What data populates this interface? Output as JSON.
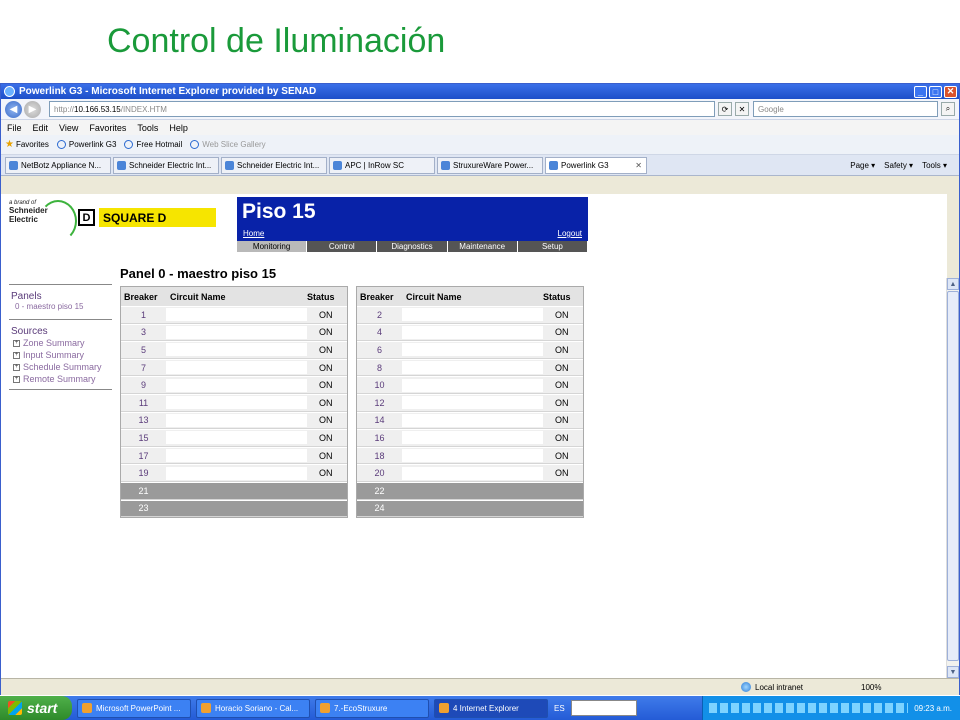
{
  "slide": {
    "title": "Control de Iluminación"
  },
  "window": {
    "title": "Powerlink G3 - Microsoft Internet Explorer provided by SENAD",
    "url_prefix": "http://",
    "url_host": "10.166.53.15",
    "url_path": "/INDEX.HTM",
    "search_placeholder": "Google"
  },
  "menu": [
    "File",
    "Edit",
    "View",
    "Favorites",
    "Tools",
    "Help"
  ],
  "favorites": {
    "label": "Favorites",
    "items": [
      "Powerlink G3",
      "Free Hotmail",
      "Web Slice Gallery"
    ]
  },
  "tabs": [
    {
      "label": "NetBotz Appliance N..."
    },
    {
      "label": "Schneider Electric Int..."
    },
    {
      "label": "Schneider Electric Int..."
    },
    {
      "label": "APC | InRow SC"
    },
    {
      "label": "StruxureWare Power..."
    },
    {
      "label": "Powerlink G3",
      "active": true
    }
  ],
  "toolbar_right": [
    "Page ▾",
    "Safety ▾",
    "Tools ▾"
  ],
  "site": {
    "brand_line": "a brand of",
    "brand_name_1": "Schneider",
    "brand_name_2": "Electric",
    "sqd_letter": "D",
    "sqd_name": "SQUARE D",
    "page_heading": "Piso 15",
    "home": "Home",
    "logout": "Logout",
    "nav": [
      "Monitoring",
      "Control",
      "Diagnostics",
      "Maintenance",
      "Setup"
    ],
    "panel_title": "Panel 0 - maestro piso 15"
  },
  "sidebar": {
    "panels_label": "Panels",
    "panel_item": "0 - maestro piso 15",
    "sources_label": "Sources",
    "sources": [
      "Zone Summary",
      "Input Summary",
      "Schedule Summary",
      "Remote Summary"
    ]
  },
  "table": {
    "headers": {
      "breaker": "Breaker",
      "circuit": "Circuit Name",
      "status": "Status"
    },
    "left": [
      {
        "num": "1",
        "status": "ON"
      },
      {
        "num": "3",
        "status": "ON"
      },
      {
        "num": "5",
        "status": "ON"
      },
      {
        "num": "7",
        "status": "ON"
      },
      {
        "num": "9",
        "status": "ON"
      },
      {
        "num": "11",
        "status": "ON"
      },
      {
        "num": "13",
        "status": "ON"
      },
      {
        "num": "15",
        "status": "ON"
      },
      {
        "num": "17",
        "status": "ON"
      },
      {
        "num": "19",
        "status": "ON"
      },
      {
        "num": "21",
        "status": ""
      },
      {
        "num": "23",
        "status": ""
      }
    ],
    "right": [
      {
        "num": "2",
        "status": "ON"
      },
      {
        "num": "4",
        "status": "ON"
      },
      {
        "num": "6",
        "status": "ON"
      },
      {
        "num": "8",
        "status": "ON"
      },
      {
        "num": "10",
        "status": "ON"
      },
      {
        "num": "12",
        "status": "ON"
      },
      {
        "num": "14",
        "status": "ON"
      },
      {
        "num": "16",
        "status": "ON"
      },
      {
        "num": "18",
        "status": "ON"
      },
      {
        "num": "20",
        "status": "ON"
      },
      {
        "num": "22",
        "status": ""
      },
      {
        "num": "24",
        "status": ""
      }
    ]
  },
  "statusbar": {
    "zone": "Local intranet",
    "zoom": "100%"
  },
  "taskbar": {
    "start": "start",
    "tasks": [
      "Microsoft PowerPoint ...",
      "Horacio Soriano - Cal...",
      "7.-EcoStruxure",
      "4 Internet Explorer"
    ],
    "lang": "ES",
    "clock": "09:23 a.m."
  }
}
